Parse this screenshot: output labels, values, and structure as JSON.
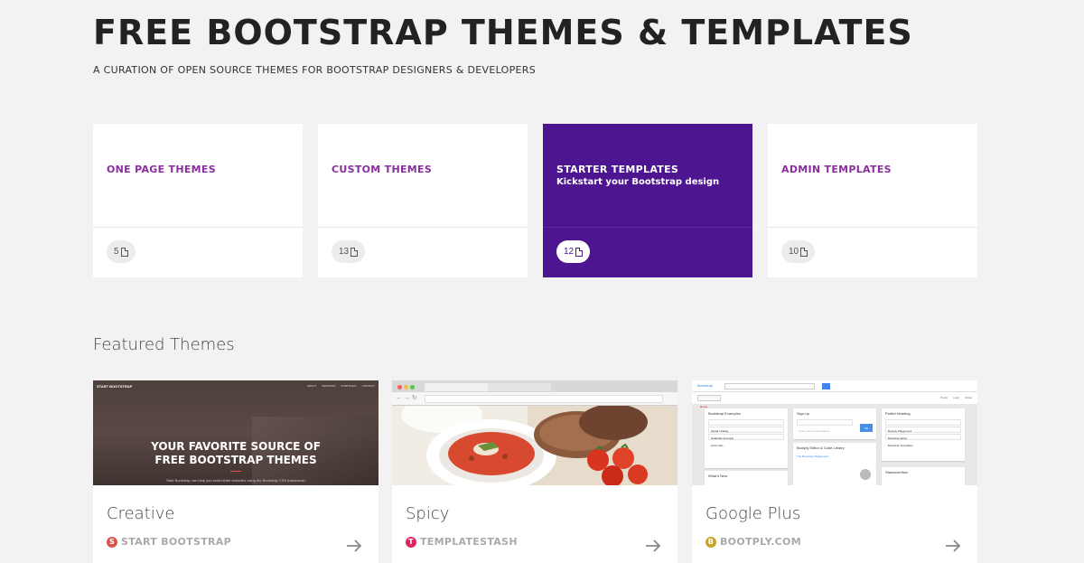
{
  "hero": {
    "title": "FREE BOOTSTRAP THEMES & TEMPLATES",
    "subtitle": "A CURATION OF OPEN SOURCE THEMES FOR BOOTSTRAP DESIGNERS & DEVELOPERS"
  },
  "categories": [
    {
      "title": "ONE PAGE THEMES",
      "description": "",
      "count": "5",
      "active": false
    },
    {
      "title": "CUSTOM THEMES",
      "description": "",
      "count": "13",
      "active": false
    },
    {
      "title": "STARTER TEMPLATES",
      "description": "Kickstart your Bootstrap design",
      "count": "12",
      "active": true
    },
    {
      "title": "ADMIN TEMPLATES",
      "description": "",
      "count": "10",
      "active": false
    }
  ],
  "featured": {
    "title": "Featured Themes",
    "themes": [
      {
        "name": "Creative",
        "author": "START BOOTSTRAP",
        "author_color": "#d9534f",
        "author_icon": "S",
        "thumb": {
          "brand": "START BOOTSTRAP",
          "nav": [
            "ABOUT",
            "SERVICES",
            "PORTFOLIO",
            "CONTACT"
          ],
          "headline_line1": "YOUR FAVORITE SOURCE OF",
          "headline_line2": "FREE BOOTSTRAP THEMES",
          "tagline": "Start Bootstrap can help you build better websites using the Bootstrap CSS framework!"
        }
      },
      {
        "name": "Spicy",
        "author": "TEMPLATESTASH",
        "author_color": "#e0245e",
        "author_icon": "T"
      },
      {
        "name": "Google Plus",
        "author": "BOOTPLY.COM",
        "author_color": "#c9a227",
        "author_icon": "B",
        "thumb": {
          "brand": "Bootstrap",
          "search_placeholder": "Search",
          "home_label": "Home",
          "tabs": [
            "Posts",
            "Login",
            "About"
          ],
          "panel1_title": "Bootstrap Examples",
          "panel1_items": [
            "Modal / Dialog",
            "Datatable Example",
            "Grid Links"
          ],
          "panel2_title": "Sign-up",
          "panel2_placeholder": "Enter your email address",
          "panel2_button": "OK",
          "panel3_title": "Bootply Editor & Code Library",
          "panel3_link": "The Bootstrap Playground",
          "panel4_title": "Portlet Heading",
          "panel4_items": [
            "Bootply Playground",
            "Bootstrap Editor",
            "Bootstrap Templates"
          ],
          "panel5_title": "Stackoverflow",
          "panel6_title": "What's New"
        }
      }
    ]
  }
}
